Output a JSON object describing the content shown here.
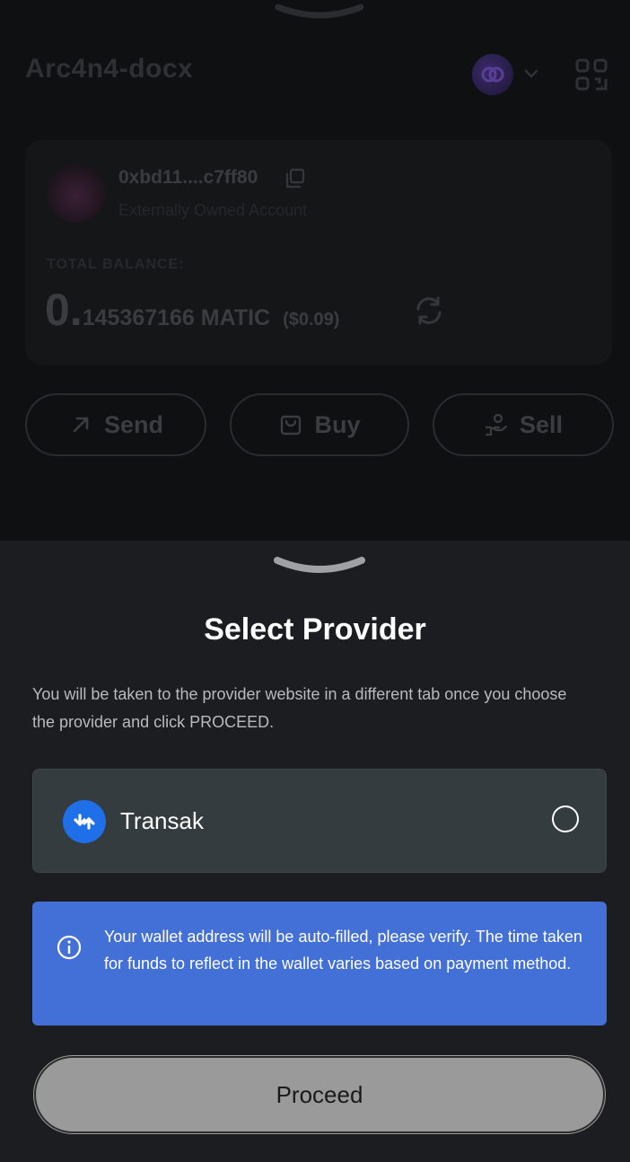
{
  "wallet": {
    "name": "Arc4n4-docx",
    "address": "0xbd11....c7ff80",
    "account_type": "Externally Owned Account",
    "total_balance_label": "TOTAL BALANCE:",
    "balance_integer": "0.",
    "balance_decimal": "145367166 MATIC",
    "balance_fiat": "($0.09)",
    "actions": {
      "send": "Send",
      "buy": "Buy",
      "sell": "Sell"
    },
    "icons": [
      "chevron-down-icon",
      "network-avatar",
      "qr-code-icon",
      "copy-icon",
      "refresh-icon",
      "arrow-up-right-icon",
      "shopping-bag-icon",
      "hand-coins-icon"
    ]
  },
  "sheet": {
    "title": "Select Provider",
    "description": "You will be taken to the provider website in a different tab once you choose the provider and click PROCEED.",
    "providers": [
      {
        "name": "Transak",
        "selected": false,
        "icon": "transak-logo-icon"
      }
    ],
    "info": "Your wallet address will be auto-filled, please verify. The time taken for funds to reflect in the wallet varies based on payment method.",
    "proceed_label": "Proceed"
  },
  "colors": {
    "info_bg": "#4370d6",
    "provider_card_bg": "#343c40",
    "proceed_bg": "#9a9a9a",
    "sheet_bg": "#1b1d21",
    "transak_blue": "#1f6fe8"
  }
}
